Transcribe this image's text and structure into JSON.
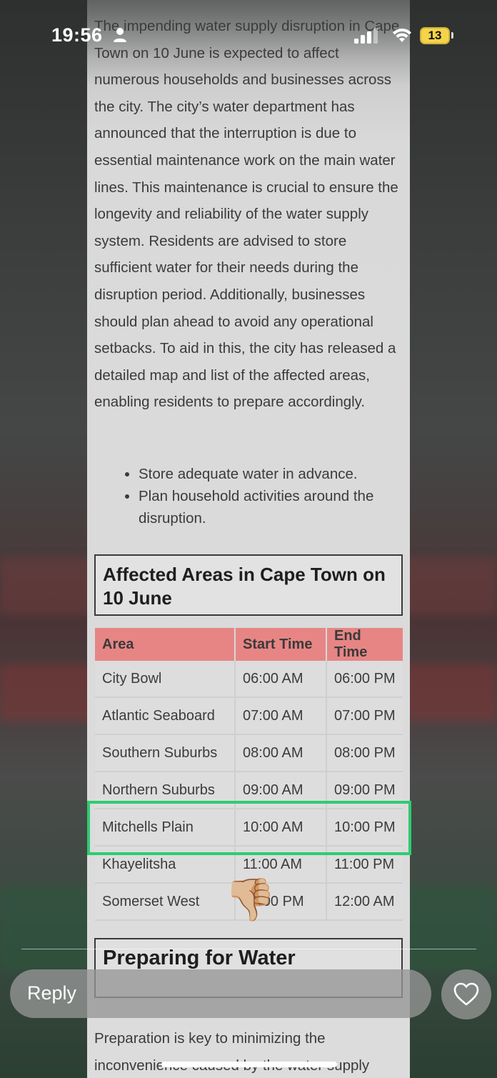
{
  "status_bar": {
    "time": "19:56",
    "battery": "13",
    "icons": [
      "person-icon",
      "signal-icon",
      "wifi-icon",
      "battery-icon"
    ]
  },
  "article": {
    "intro": "The impending water supply disruption in Cape Town on 10 June is expected to affect numerous households and businesses across the city. The city’s water department has announced that the interruption is due to essential maintenance work on the main water lines. This maintenance is crucial to ensure the longevity and reliability of the water supply system. Residents are advised to store sufficient water for their needs during the disruption period. Additionally, businesses should plan ahead to avoid any operational setbacks. To aid in this, the city has released a detailed map and list of the affected areas, enabling residents to prepare accordingly.",
    "bullets": [
      "Store adequate water in advance.",
      "Plan household activities around the disruption."
    ],
    "affected_heading": "Affected Areas in Cape Town on 10 June",
    "table": {
      "headers": [
        "Area",
        "Start Time",
        "End Time"
      ],
      "rows": [
        [
          "City Bowl",
          "06:00 AM",
          "06:00 PM"
        ],
        [
          "Atlantic Seaboard",
          "07:00 AM",
          "07:00 PM"
        ],
        [
          "Southern Suburbs",
          "08:00 AM",
          "08:00 PM"
        ],
        [
          "Northern Suburbs",
          "09:00 AM",
          "09:00 PM"
        ],
        [
          "Mitchells Plain",
          "10:00 AM",
          "10:00 PM"
        ],
        [
          "Khayelitsha",
          "11:00 AM",
          "11:00 PM"
        ],
        [
          "Somerset West",
          "12:00 PM",
          "12:00 AM"
        ]
      ],
      "highlighted_row": "Mitchells Plain",
      "highlight_color": "#2ecc71",
      "header_color": "#e78585"
    },
    "reaction_emoji": "👎🏼",
    "prep_heading": "Preparing for Water",
    "prep_text": "Preparation is key to minimizing the inconvenience caused by the water supply"
  },
  "reply_bar": {
    "placeholder": "Reply",
    "like_icon": "heart-icon"
  }
}
